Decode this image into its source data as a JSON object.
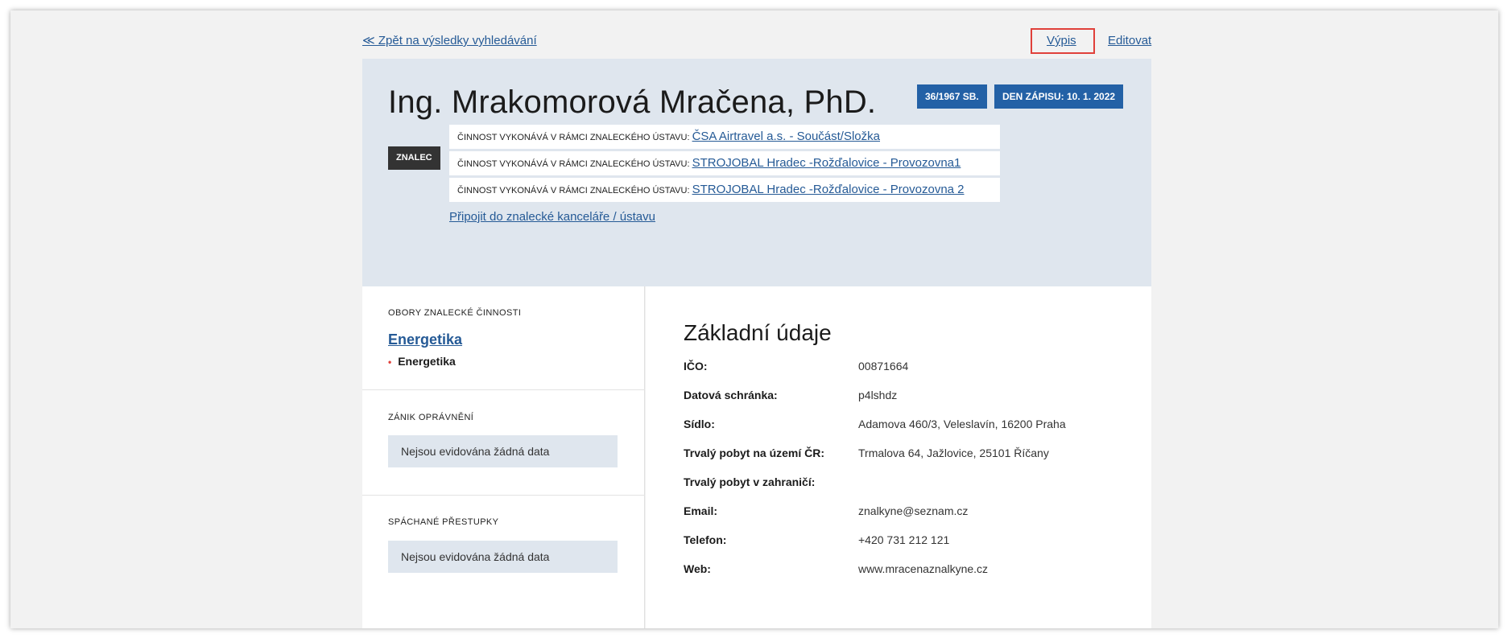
{
  "nav": {
    "back_label": "≪ Zpět na výsledky vyhledávání",
    "vypis_label": "Výpis",
    "edit_label": "Editovat"
  },
  "header": {
    "name": "Ing. Mrakomorová Mračena, PhD.",
    "badge_law": "36/1967 SB.",
    "badge_date": "DEN ZÁPISU: 10. 1. 2022",
    "role_badge": "ZNALEC",
    "activities": [
      {
        "prefix": "ČINNOST VYKONÁVÁ V RÁMCI ZNALECKÉHO ÚSTAVU:",
        "link": "ČSA Airtravel a.s. - Součást/Složka"
      },
      {
        "prefix": "ČINNOST VYKONÁVÁ V RÁMCI ZNALECKÉHO ÚSTAVU:",
        "link": "STROJOBAL Hradec -Rožďalovice - Provozovna1"
      },
      {
        "prefix": "ČINNOST VYKONÁVÁ V RÁMCI ZNALECKÉHO ÚSTAVU:",
        "link": "STROJOBAL Hradec -Rožďalovice - Provozovna 2"
      }
    ],
    "attach_label": "Připojit do znalecké kanceláře / ústavu"
  },
  "sidebar": {
    "fields_title": "OBORY ZNALECKÉ ČINNOSTI",
    "field_link": "Energetika",
    "field_item": "Energetika",
    "termination_title": "ZÁNIK OPRÁVNĚNÍ",
    "termination_empty": "Nejsou evidována žádná data",
    "offenses_title": "SPÁCHANÉ PŘESTUPKY",
    "offenses_empty": "Nejsou evidována žádná data"
  },
  "main": {
    "title": "Základní údaje",
    "rows": [
      {
        "label": "IČO:",
        "value": "00871664"
      },
      {
        "label": "Datová schránka:",
        "value": "p4lshdz"
      },
      {
        "label": "Sídlo:",
        "value": "Adamova 460/3, Veleslavín, 16200 Praha"
      },
      {
        "label": "Trvalý pobyt na území ČR:",
        "value": "Trmalova 64, Jažlovice, 25101 Říčany"
      },
      {
        "label": "Trvalý pobyt v zahraničí:",
        "value": ""
      },
      {
        "label": "Email:",
        "value": "znalkyne@seznam.cz"
      },
      {
        "label": "Telefon:",
        "value": "+420 731 212 121"
      },
      {
        "label": "Web:",
        "value": "www.mracenaznalkyne.cz"
      }
    ]
  },
  "colors": {
    "link": "#255a96",
    "badge_blue": "#2361a6",
    "header_bg": "#dfe6ee",
    "highlight": "#e0403a"
  }
}
